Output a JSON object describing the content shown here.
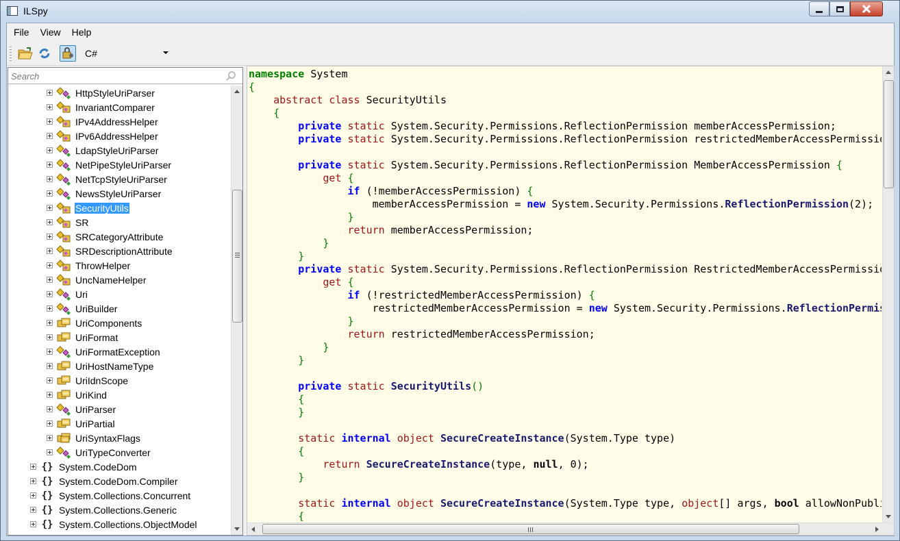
{
  "window": {
    "title": "ILSpy"
  },
  "menu": {
    "items": [
      "File",
      "View",
      "Help"
    ]
  },
  "toolbar": {
    "icons": [
      "open-folder-icon",
      "refresh-icon",
      "show-internal-api-icon"
    ],
    "language": "C#"
  },
  "search": {
    "placeholder": "Search"
  },
  "tree": {
    "type_items": [
      {
        "label": "HttpStyleUriParser",
        "icon": "class-icon"
      },
      {
        "label": "InvariantComparer",
        "icon": "class-internal-icon"
      },
      {
        "label": "IPv4AddressHelper",
        "icon": "class-internal-icon"
      },
      {
        "label": "IPv6AddressHelper",
        "icon": "class-internal-icon"
      },
      {
        "label": "LdapStyleUriParser",
        "icon": "class-icon"
      },
      {
        "label": "NetPipeStyleUriParser",
        "icon": "class-icon"
      },
      {
        "label": "NetTcpStyleUriParser",
        "icon": "class-icon"
      },
      {
        "label": "NewsStyleUriParser",
        "icon": "class-icon"
      },
      {
        "label": "SecurityUtils",
        "icon": "class-internal-icon",
        "selected": true
      },
      {
        "label": "SR",
        "icon": "class-internal-icon"
      },
      {
        "label": "SRCategoryAttribute",
        "icon": "class-internal-icon"
      },
      {
        "label": "SRDescriptionAttribute",
        "icon": "class-internal-icon"
      },
      {
        "label": "ThrowHelper",
        "icon": "class-internal-icon"
      },
      {
        "label": "UncNameHelper",
        "icon": "class-internal-icon"
      },
      {
        "label": "Uri",
        "icon": "class-icon"
      },
      {
        "label": "UriBuilder",
        "icon": "class-icon"
      },
      {
        "label": "UriComponents",
        "icon": "enum-icon"
      },
      {
        "label": "UriFormat",
        "icon": "enum-icon"
      },
      {
        "label": "UriFormatException",
        "icon": "class-icon"
      },
      {
        "label": "UriHostNameType",
        "icon": "enum-icon"
      },
      {
        "label": "UriIdnScope",
        "icon": "enum-icon"
      },
      {
        "label": "UriKind",
        "icon": "enum-icon"
      },
      {
        "label": "UriParser",
        "icon": "class-icon"
      },
      {
        "label": "UriPartial",
        "icon": "enum-icon"
      },
      {
        "label": "UriSyntaxFlags",
        "icon": "enum-internal-icon"
      },
      {
        "label": "UriTypeConverter",
        "icon": "class-icon"
      }
    ],
    "namespace_items": [
      "System.CodeDom",
      "System.CodeDom.Compiler",
      "System.Collections.Concurrent",
      "System.Collections.Generic",
      "System.Collections.ObjectModel"
    ],
    "namespace_icon": "namespace-icon",
    "namespace_glyph": "{}"
  },
  "code": {
    "lines": [
      [
        [
          "kw-g",
          "namespace"
        ],
        [
          "",
          "System"
        ]
      ],
      [
        [
          "brace",
          "{"
        ]
      ],
      [
        [
          "",
          "    "
        ],
        [
          "kw-r",
          "abstract class"
        ],
        [
          "",
          "SecurityUtils"
        ]
      ],
      [
        [
          "",
          "    "
        ],
        [
          "brace",
          "{"
        ]
      ],
      [
        [
          "",
          "        "
        ],
        [
          "kw-b",
          "private"
        ],
        [
          "kw-r",
          "static"
        ],
        [
          "",
          "System.Security.Permissions.ReflectionPermission memberAccessPermission;"
        ]
      ],
      [
        [
          "",
          "        "
        ],
        [
          "kw-b",
          "private"
        ],
        [
          "kw-r",
          "static"
        ],
        [
          "",
          "System.Security.Permissions.ReflectionPermission restrictedMemberAccessPermissio"
        ]
      ],
      [],
      [
        [
          "",
          "        "
        ],
        [
          "kw-b",
          "private"
        ],
        [
          "kw-r",
          "static"
        ],
        [
          "",
          "System.Security.Permissions.ReflectionPermission MemberAccessPermission "
        ],
        [
          "brace",
          "{"
        ]
      ],
      [
        [
          "",
          "            "
        ],
        [
          "kw-r",
          "get"
        ],
        [
          "brace",
          " {"
        ]
      ],
      [
        [
          "",
          "                "
        ],
        [
          "kw-b",
          "if"
        ],
        [
          "",
          " (!memberAccessPermission) "
        ],
        [
          "brace",
          "{"
        ]
      ],
      [
        [
          "",
          "                    memberAccessPermission = "
        ],
        [
          "kw-b",
          "new"
        ],
        [
          "",
          " System.Security.Permissions."
        ],
        [
          "mname",
          "ReflectionPermission"
        ],
        [
          "",
          "(2);"
        ]
      ],
      [
        [
          "",
          "                "
        ],
        [
          "brace",
          "}"
        ]
      ],
      [
        [
          "",
          "                "
        ],
        [
          "kw-r",
          "return"
        ],
        [
          "",
          " memberAccessPermission;"
        ]
      ],
      [
        [
          "",
          "            "
        ],
        [
          "brace",
          "}"
        ]
      ],
      [
        [
          "",
          "        "
        ],
        [
          "brace",
          "}"
        ]
      ],
      [
        [
          "",
          "        "
        ],
        [
          "kw-b",
          "private"
        ],
        [
          "kw-r",
          "static"
        ],
        [
          "",
          "System.Security.Permissions.ReflectionPermission RestrictedMemberAccessPermissio"
        ]
      ],
      [
        [
          "",
          "            "
        ],
        [
          "kw-r",
          "get"
        ],
        [
          "brace",
          " {"
        ]
      ],
      [
        [
          "",
          "                "
        ],
        [
          "kw-b",
          "if"
        ],
        [
          "",
          " (!restrictedMemberAccessPermission) "
        ],
        [
          "brace",
          "{"
        ]
      ],
      [
        [
          "",
          "                    restrictedMemberAccessPermission = "
        ],
        [
          "kw-b",
          "new"
        ],
        [
          "",
          " System.Security.Permissions."
        ],
        [
          "mname",
          "ReflectionPermis"
        ]
      ],
      [
        [
          "",
          "                "
        ],
        [
          "brace",
          "}"
        ]
      ],
      [
        [
          "",
          "                "
        ],
        [
          "kw-r",
          "return"
        ],
        [
          "",
          " restrictedMemberAccessPermission;"
        ]
      ],
      [
        [
          "",
          "            "
        ],
        [
          "brace",
          "}"
        ]
      ],
      [
        [
          "",
          "        "
        ],
        [
          "brace",
          "}"
        ]
      ],
      [],
      [
        [
          "",
          "        "
        ],
        [
          "kw-b",
          "private"
        ],
        [
          "kw-r",
          "static"
        ],
        [
          "mname",
          "SecurityUtils"
        ],
        [
          "brace",
          "()"
        ]
      ],
      [
        [
          "",
          "        "
        ],
        [
          "brace",
          "{"
        ]
      ],
      [
        [
          "",
          "        "
        ],
        [
          "brace",
          "}"
        ]
      ],
      [],
      [
        [
          "",
          "        "
        ],
        [
          "kw-r",
          "static"
        ],
        [
          "kw-b",
          "internal"
        ],
        [
          "kw-r",
          "object"
        ],
        [
          "mname",
          "SecureCreateInstance"
        ],
        [
          "",
          "(System.Type type)"
        ]
      ],
      [
        [
          "",
          "        "
        ],
        [
          "brace",
          "{"
        ]
      ],
      [
        [
          "",
          "            "
        ],
        [
          "kw-r",
          "return"
        ],
        [
          "mname",
          "SecureCreateInstance"
        ],
        [
          "",
          "(type, "
        ],
        [
          "kw-n",
          "null"
        ],
        [
          "",
          ", 0);"
        ]
      ],
      [
        [
          "",
          "        "
        ],
        [
          "brace",
          "}"
        ]
      ],
      [],
      [
        [
          "",
          "        "
        ],
        [
          "kw-r",
          "static"
        ],
        [
          "kw-b",
          "internal"
        ],
        [
          "kw-r",
          "object"
        ],
        [
          "mname",
          "SecureCreateInstance"
        ],
        [
          "",
          "(System.Type type, "
        ],
        [
          "kw-r",
          "object"
        ],
        [
          "",
          "[] args, "
        ],
        [
          "kw-n",
          "bool"
        ],
        [
          "",
          " allowNonPubli"
        ]
      ],
      [
        [
          "",
          "        "
        ],
        [
          "brace",
          "{"
        ]
      ]
    ]
  }
}
